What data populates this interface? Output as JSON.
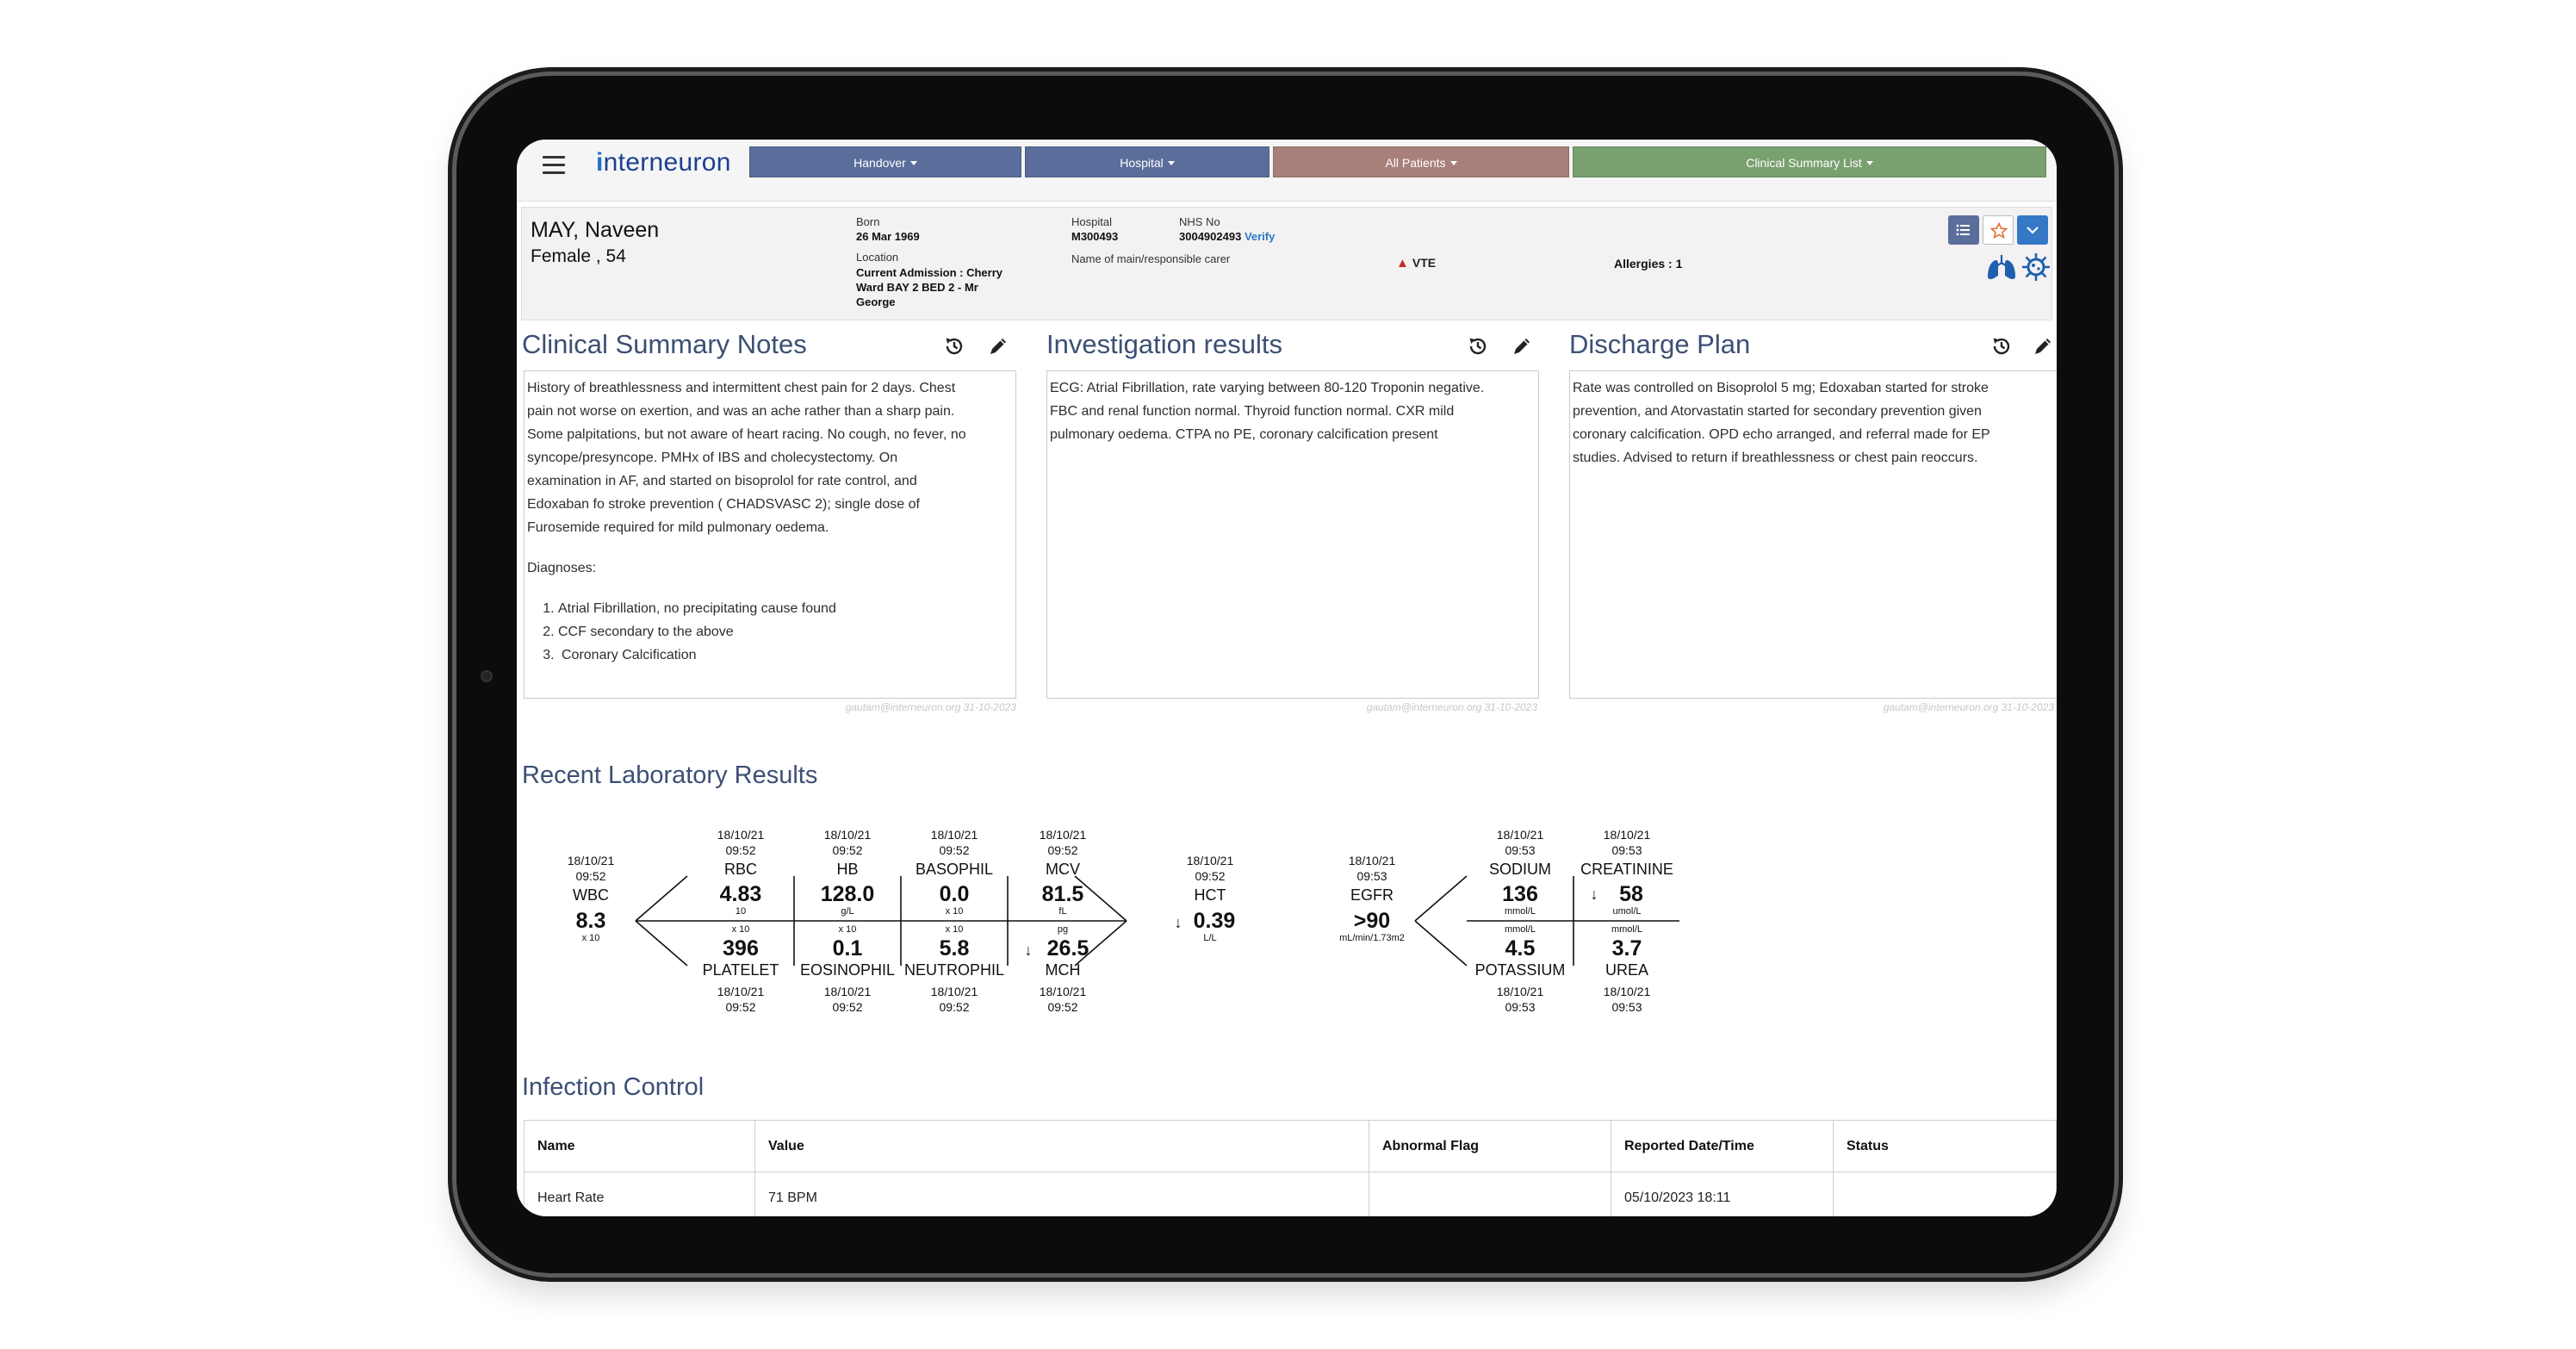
{
  "app": {
    "logo_prefix": "i",
    "logo_rest": "nterneuron"
  },
  "nav": {
    "tabs": [
      {
        "label": "Handover",
        "color": "#5b6d9a"
      },
      {
        "label": "Hospital",
        "color": "#5b6d9a"
      },
      {
        "label": "All Patients",
        "color": "#a97f7b"
      },
      {
        "label": "Clinical Summary List",
        "color": "#79a06f"
      }
    ]
  },
  "patient": {
    "name": "MAY, Naveen",
    "gender_age": "Female , 54",
    "born_label": "Born",
    "born_value": "26 Mar 1969",
    "location_label": "Location",
    "location_value_1": "Current Admission : Cherry",
    "location_value_2": "Ward BAY 2 BED 2 - Mr",
    "location_value_3": "George",
    "hospital_label": "Hospital",
    "hospital_value": "M300493",
    "nhs_label": "NHS No",
    "nhs_value": "3004902493",
    "verify_label": "Verify",
    "carer_label": "Name of main/responsible carer",
    "vte_label": "VTE",
    "allergies": "Allergies : 1"
  },
  "panels": {
    "clinical": {
      "title": "Clinical Summary Notes",
      "lines": [
        "History of  breathlessness and intermittent chest pain for 2 days. Chest",
        "pain not worse on exertion, and was an ache rather than a sharp pain.",
        "Some palpitations, but not aware of heart racing. No cough, no fever, no",
        "syncope/presyncope.  PMHx of IBS and cholecystectomy.   On",
        "examination in AF, and started on bisoprolol for rate control, and",
        "Edoxaban fo stroke prevention ( CHADSVASC 2); single dose of",
        "Furosemide required for mild pulmonary oedema."
      ],
      "diagnoses_label": "Diagnoses:",
      "diagnoses": [
        "Atrial Fibrillation, no precipitating cause found",
        "CCF secondary to the above",
        "Coronary Calcification"
      ],
      "stamp": "gautam@interneuron.org 31-10-2023"
    },
    "investigation": {
      "title": "Investigation results",
      "lines": [
        "ECG: Atrial Fibrillation, rate varying between 80-120  Troponin negative.",
        " FBC and renal function normal.  Thyroid function normal.  CXR mild",
        "pulmonary oedema. CTPA no PE, coronary calcification present"
      ],
      "stamp": "gautam@interneuron.org 31-10-2023"
    },
    "discharge": {
      "title": "Discharge Plan",
      "lines": [
        "Rate was controlled on Bisoprolol 5 mg; Edoxaban started for stroke",
        "prevention, and Atorvastatin started for secondary prevention given",
        "coronary calcification.  OPD echo arranged, and referral made for EP",
        "studies.  Advised to return if breathlessness or chest pain reoccurs."
      ],
      "stamp": "gautam@interneuron.org 31-10-2023"
    }
  },
  "labs": {
    "title": "Recent Laboratory Results",
    "fbc": {
      "left": {
        "date": "18/10/21",
        "time": "09:52",
        "name": "WBC",
        "value": "8.3",
        "unit": "x 10"
      },
      "columns": [
        {
          "top": {
            "date": "18/10/21",
            "time": "09:52",
            "name": "RBC",
            "value": "4.83",
            "unit": "10"
          },
          "bottom": {
            "date": "18/10/21",
            "time": "09:52",
            "name": "PLATELET",
            "value": "396",
            "unit": "x 10",
            "arrow": ""
          }
        },
        {
          "top": {
            "date": "18/10/21",
            "time": "09:52",
            "name": "HB",
            "value": "128.0",
            "unit": "g/L"
          },
          "bottom": {
            "date": "18/10/21",
            "time": "09:52",
            "name": "EOSINOPHIL",
            "value": "0.1",
            "unit": "x 10",
            "arrow": ""
          }
        },
        {
          "top": {
            "date": "18/10/21",
            "time": "09:52",
            "name": "BASOPHIL",
            "value": "0.0",
            "unit": "x 10"
          },
          "bottom": {
            "date": "18/10/21",
            "time": "09:52",
            "name": "NEUTROPHIL",
            "value": "5.8",
            "unit": "x 10",
            "arrow": ""
          }
        },
        {
          "top": {
            "date": "18/10/21",
            "time": "09:52",
            "name": "MCV",
            "value": "81.5",
            "unit": "fL"
          },
          "bottom": {
            "date": "18/10/21",
            "time": "09:52",
            "name": "MCH",
            "value": "26.5",
            "unit": "pg",
            "arrow": "↓"
          }
        }
      ],
      "right": {
        "date": "18/10/21",
        "time": "09:52",
        "name": "HCT",
        "value": "0.39",
        "unit": "L/L",
        "arrow": "↓"
      }
    },
    "renal": {
      "left": {
        "date": "18/10/21",
        "time": "09:53",
        "name": "EGFR",
        "value": ">90",
        "unit": "mL/min/1.73m2"
      },
      "columns": [
        {
          "top": {
            "date": "18/10/21",
            "time": "09:53",
            "name": "SODIUM",
            "value": "136",
            "unit": "mmol/L",
            "arrow": ""
          },
          "bottom": {
            "date": "18/10/21",
            "time": "09:53",
            "name": "POTASSIUM",
            "value": "4.5",
            "unit": "mmol/L",
            "arrow": ""
          }
        },
        {
          "top": {
            "date": "18/10/21",
            "time": "09:53",
            "name": "CREATININE",
            "value": "58",
            "unit": "umol/L",
            "arrow": "↓"
          },
          "bottom": {
            "date": "18/10/21",
            "time": "09:53",
            "name": "UREA",
            "value": "3.7",
            "unit": "mmol/L",
            "arrow": ""
          }
        }
      ]
    }
  },
  "infection": {
    "title": "Infection Control",
    "headers": [
      "Name",
      "Value",
      "Abnormal Flag",
      "Reported Date/Time",
      "Status"
    ],
    "rows": [
      [
        "Heart Rate",
        "71 BPM",
        "",
        "05/10/2023 18:11",
        ""
      ]
    ]
  },
  "colors": {
    "title": "#3c4f74",
    "list_btn": "#5b6d9a",
    "star_btn": "#e2703a",
    "chevron_btn": "#3478c6",
    "icon_blue": "#1f5fae"
  }
}
